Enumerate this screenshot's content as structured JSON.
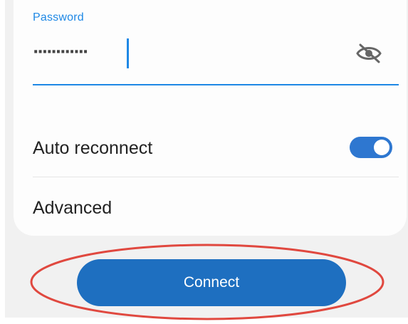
{
  "password_field": {
    "label": "Password",
    "masked_value": "············",
    "visibility_icon": "eye-off-icon"
  },
  "settings": {
    "auto_reconnect": {
      "label": "Auto reconnect",
      "enabled": true
    },
    "advanced": {
      "label": "Advanced"
    }
  },
  "actions": {
    "connect_label": "Connect"
  },
  "colors": {
    "accent": "#1e88e5",
    "button": "#1e6fc0",
    "toggle_on": "#2e77d0",
    "highlight": "#e0483f"
  }
}
